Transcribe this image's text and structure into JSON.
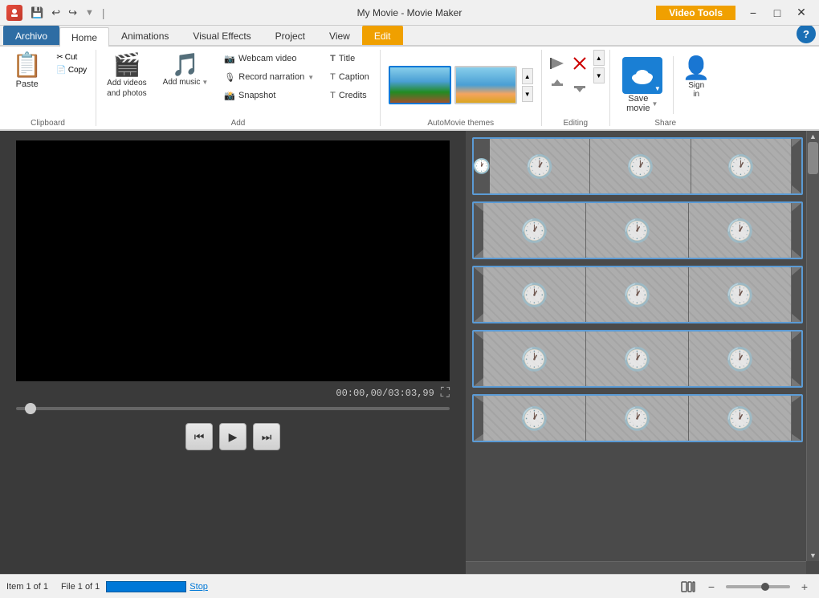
{
  "titlebar": {
    "app_name": "My Movie - Movie Maker",
    "video_tools_label": "Video Tools",
    "qat_icons": [
      "save",
      "undo",
      "redo"
    ],
    "window_controls": [
      "minimize",
      "maximize",
      "close"
    ]
  },
  "tabs": {
    "archivo": "Archivo",
    "home": "Home",
    "animations": "Animations",
    "visual_effects": "Visual Effects",
    "project": "Project",
    "view": "View",
    "edit": "Edit",
    "help_icon": "?"
  },
  "ribbon": {
    "clipboard": {
      "label": "Clipboard",
      "paste": "Paste",
      "cut": "Cut",
      "copy": "Copy"
    },
    "add": {
      "label": "Add",
      "add_videos": "Add videos\nand photos",
      "add_music": "Add\nmusic",
      "webcam_video": "Webcam video",
      "record_narration": "Record narration",
      "snapshot": "Snapshot",
      "title": "Title",
      "caption": "Caption",
      "credits": "Credits"
    },
    "automovie": {
      "label": "AutoMovie themes"
    },
    "editing": {
      "label": "Editing"
    },
    "share": {
      "label": "Share",
      "save_movie": "Save\nmovie",
      "sign_in": "Sign\nin"
    }
  },
  "preview": {
    "time_current": "00:00,00",
    "time_total": "03:03,99",
    "fullscreen_tooltip": "Fullscreen"
  },
  "controls": {
    "prev_frame": "⏮",
    "play": "▶",
    "next_frame": "⏭"
  },
  "status": {
    "item_label": "Item 1 of 1",
    "file_label": "File 1 of 1",
    "stop_label": "Stop"
  }
}
